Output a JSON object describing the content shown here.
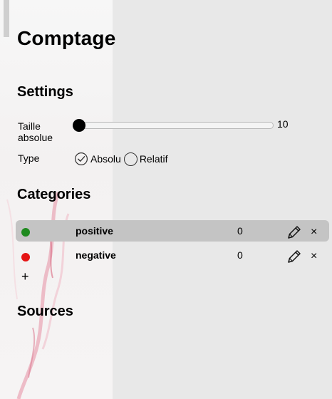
{
  "app": {
    "title": "Comptage"
  },
  "settings": {
    "heading": "Settings",
    "size": {
      "label": "Taille absolue",
      "value": "10",
      "level_fraction": 0.0
    },
    "type": {
      "label": "Type",
      "options": [
        {
          "label": "Absolu",
          "selected": true,
          "icon": "check-circle-icon"
        },
        {
          "label": "Relatif",
          "selected": false,
          "icon": "radio-circle-icon"
        }
      ]
    }
  },
  "categories": {
    "heading": "Categories",
    "items": [
      {
        "name": "positive",
        "count": "0",
        "color": "#1e8a1e",
        "active": true
      },
      {
        "name": "negative",
        "count": "0",
        "color": "#e51515",
        "active": false
      }
    ],
    "add_label": "+"
  },
  "sources": {
    "heading": "Sources"
  },
  "icons": {
    "edit": "pencil-icon",
    "delete": "close-icon",
    "delete_glyph": "×"
  }
}
